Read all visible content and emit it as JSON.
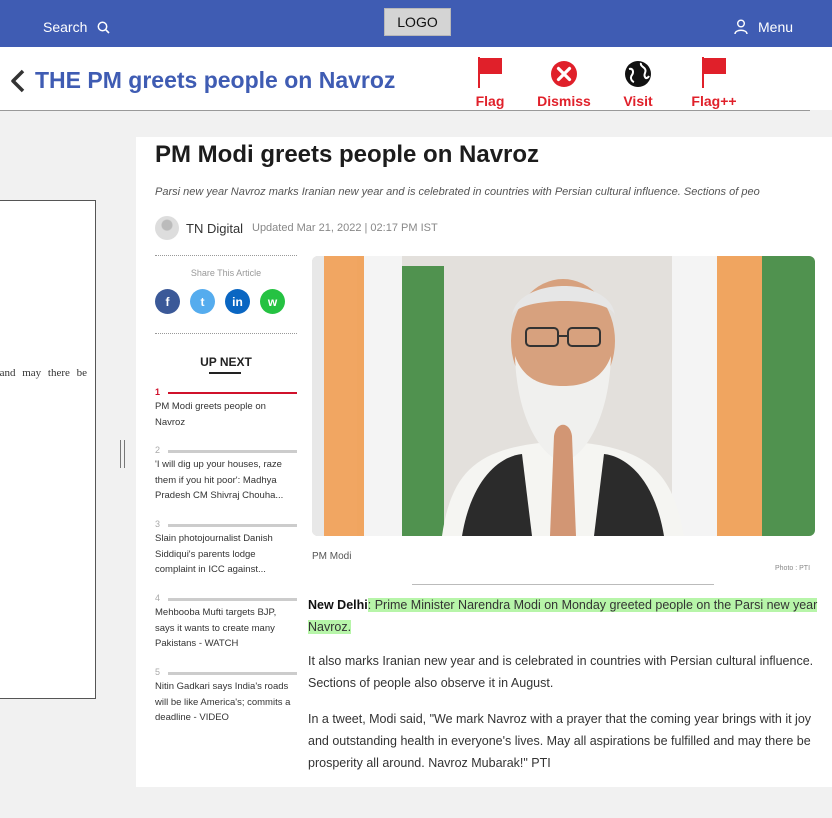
{
  "topbar": {
    "search_label": "Search",
    "logo": "LOGO",
    "menu_label": "Menu",
    "color": "#3f5cb3"
  },
  "header": {
    "headline": "THE PM greets people on Navroz",
    "actions": [
      {
        "label": "Flag",
        "icon": "red-flag-icon"
      },
      {
        "label": "Dismiss",
        "icon": "x-circle-icon"
      },
      {
        "label": "Visit",
        "icon": "globe-icon"
      },
      {
        "label": "Flag++",
        "icon": "red-flag-icon"
      }
    ],
    "action_color": "#e0202a"
  },
  "left_doc": {
    "snippet": "and may there be"
  },
  "article": {
    "title": "PM Modi greets people on Navroz",
    "subtitle": "Parsi new year Navroz marks Iranian new year and is celebrated in countries with Persian cultural influence. Sections of peo",
    "author": "TN Digital",
    "updated": "Updated Mar 21, 2022 | 02:17 PM IST",
    "share_label": "Share This Article",
    "share_buttons": [
      "f",
      "t",
      "in",
      "w"
    ],
    "up_next_label": "UP NEXT",
    "up_next": [
      {
        "num": "1",
        "text": "PM Modi greets people on Navroz"
      },
      {
        "num": "2",
        "text": "'I will dig up your houses, raze them if you hit poor': Madhya Pradesh CM Shivraj Chouha..."
      },
      {
        "num": "3",
        "text": "Slain photojournalist Danish Siddiqui's parents lodge complaint in ICC against..."
      },
      {
        "num": "4",
        "text": "Mehbooba Mufti targets BJP, says it wants to create many Pakistans - WATCH"
      },
      {
        "num": "5",
        "text": "Nitin Gadkari says India's roads will be like America's; commits a deadline - VIDEO"
      }
    ],
    "photo_caption": "PM Modi",
    "photo_credit": "Photo : PTI",
    "dateline": "New Delhi",
    "p1_highlight": ": Prime Minister Narendra Modi on Monday greeted people on the Parsi new year Navroz.",
    "p2": "It also marks Iranian new year and is celebrated in countries with Persian cultural influence. Sections of people also observe it in August.",
    "p3": "In a tweet, Modi said, \"We mark Navroz with a prayer that the coming year brings with it joy and outstanding health in everyone's lives. May all aspirations be fulfilled and may there be prosperity all around. Navroz Mubarak!\" PTI",
    "highlight_color": "#b7f5a9"
  }
}
